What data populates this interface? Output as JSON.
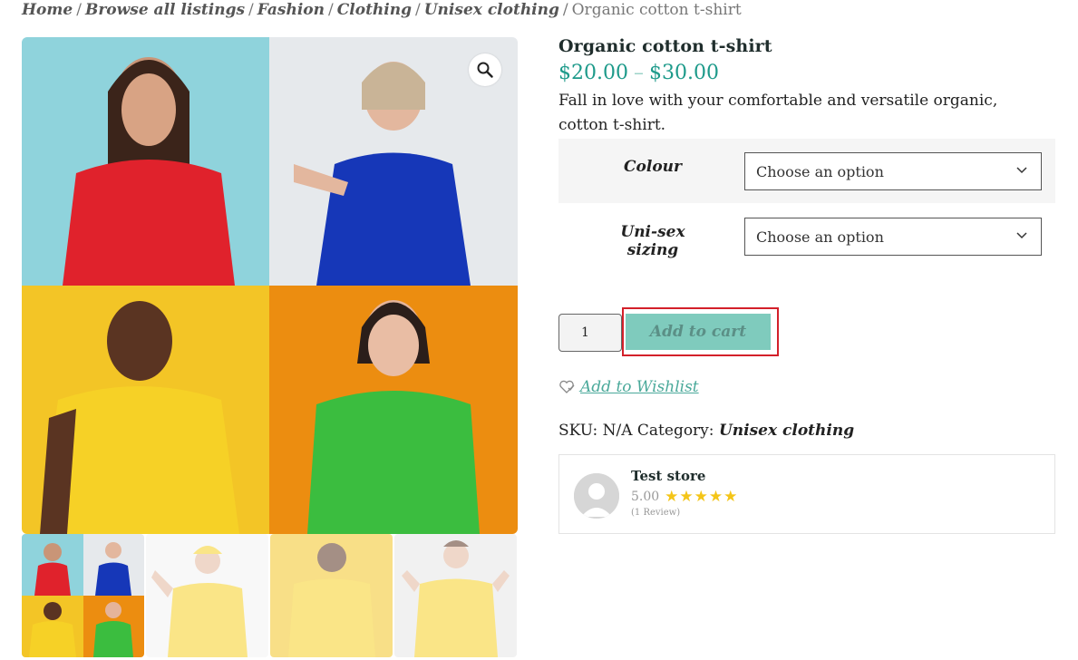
{
  "breadcrumb": {
    "items": [
      "Home",
      "Browse all listings",
      "Fashion",
      "Clothing",
      "Unisex clothing"
    ],
    "separator": "/",
    "current": "Organic cotton t-shirt"
  },
  "gallery": {
    "zoom_icon": "magnifier-icon",
    "thumbnails": 4
  },
  "product": {
    "title": "Organic cotton t-shirt",
    "price_low": "$20.00",
    "price_dash": "–",
    "price_high": "$30.00",
    "description": "Fall in love with your comfortable and versatile organic, cotton t-shirt."
  },
  "variations": [
    {
      "label": "Colour",
      "selected": "Choose an option"
    },
    {
      "label": "Uni-sex sizing",
      "selected": "Choose an option"
    }
  ],
  "cart": {
    "quantity": "1",
    "button_label": "Add to cart"
  },
  "wishlist": {
    "label": "Add to Wishlist",
    "icon": "heart-icon"
  },
  "meta": {
    "sku_label": "SKU:",
    "sku_value": "N/A",
    "category_label": "Category:",
    "category_value": "Unisex clothing"
  },
  "store": {
    "name": "Test store",
    "rating": "5.00",
    "stars": 5,
    "reviews": "(1 Review)"
  },
  "colors": {
    "accent": "#1d9a8a",
    "button": "#7fcbbd",
    "highlight": "#d3202a",
    "star": "#f4c518"
  }
}
